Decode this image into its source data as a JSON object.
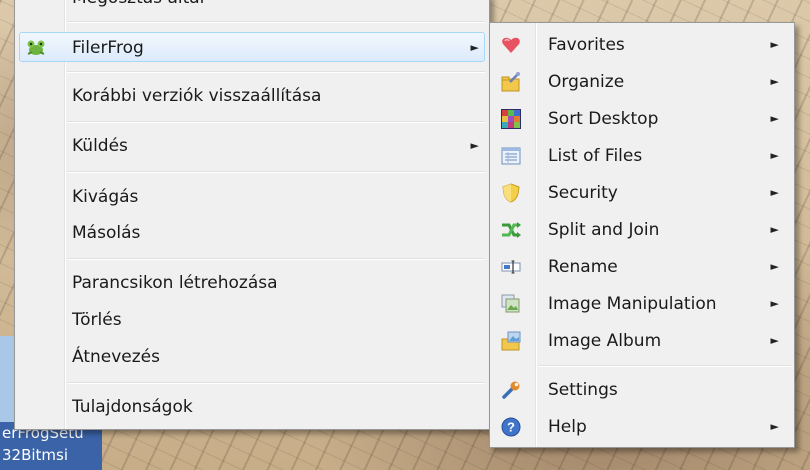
{
  "desktop": {
    "icon_label_lines": [
      "erFrogSetu",
      "32Bitmsi"
    ]
  },
  "context_menu": {
    "items": [
      {
        "label": "Megosztás által",
        "arrow": false
      },
      {
        "label": "FilerFrog",
        "arrow": true,
        "highlighted": true,
        "icon": "frog-icon"
      },
      {
        "label": "Korábbi verziók visszaállítása",
        "arrow": false
      },
      {
        "label": "Küldés",
        "arrow": true
      },
      {
        "label": "Kivágás",
        "arrow": false
      },
      {
        "label": "Másolás",
        "arrow": false
      },
      {
        "label": "Parancsikon létrehozása",
        "arrow": false
      },
      {
        "label": "Törlés",
        "arrow": false
      },
      {
        "label": "Átnevezés",
        "arrow": false
      },
      {
        "label": "Tulajdonságok",
        "arrow": false
      }
    ],
    "arrow_glyph": "►"
  },
  "submenu": {
    "items": [
      {
        "label": "Favorites",
        "icon": "heart-icon",
        "arrow": true
      },
      {
        "label": "Organize",
        "icon": "organize-folder-icon",
        "arrow": true
      },
      {
        "label": "Sort Desktop",
        "icon": "color-grid-icon",
        "arrow": true
      },
      {
        "label": "List of Files",
        "icon": "file-list-icon",
        "arrow": true
      },
      {
        "label": "Security",
        "icon": "shield-icon",
        "arrow": true
      },
      {
        "label": "Split and Join",
        "icon": "split-join-icon",
        "arrow": true
      },
      {
        "label": "Rename",
        "icon": "rename-icon",
        "arrow": true
      },
      {
        "label": "Image Manipulation",
        "icon": "image-manipulation-icon",
        "arrow": true
      },
      {
        "label": "Image Album",
        "icon": "image-album-icon",
        "arrow": true
      },
      {
        "label": "Settings",
        "icon": "wrench-icon",
        "arrow": false
      },
      {
        "label": "Help",
        "icon": "help-icon",
        "arrow": true
      }
    ]
  }
}
